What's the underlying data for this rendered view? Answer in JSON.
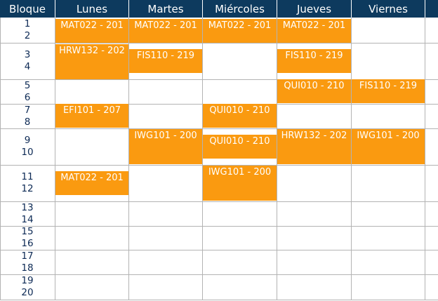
{
  "header": {
    "bloque_label": "Bloque",
    "days": [
      "Lunes",
      "Martes",
      "Miércoles",
      "Jueves",
      "Viernes"
    ]
  },
  "rows": [
    {
      "top": "1",
      "bottom": "2"
    },
    {
      "top": "3",
      "bottom": "4"
    },
    {
      "top": "5",
      "bottom": "6"
    },
    {
      "top": "7",
      "bottom": "8"
    },
    {
      "top": "9",
      "bottom": "10"
    },
    {
      "top": "11",
      "bottom": "12"
    },
    {
      "top": "13",
      "bottom": "14"
    },
    {
      "top": "15",
      "bottom": "16"
    },
    {
      "top": "17",
      "bottom": "18"
    },
    {
      "top": "19",
      "bottom": "20"
    }
  ],
  "courses": [
    {
      "day": 0,
      "row": 0,
      "label": "MAT022 - 201"
    },
    {
      "day": 1,
      "row": 0,
      "label": "MAT022 - 201"
    },
    {
      "day": 2,
      "row": 0,
      "label": "MAT022 - 201"
    },
    {
      "day": 3,
      "row": 0,
      "label": "MAT022 - 201"
    },
    {
      "day": 0,
      "row": 1,
      "label": "HRW132 - 202"
    },
    {
      "day": 1,
      "row": 1,
      "label": "FIS110 - 219"
    },
    {
      "day": 3,
      "row": 1,
      "label": "FIS110 - 219"
    },
    {
      "day": 3,
      "row": 2,
      "label": "QUI010 - 210"
    },
    {
      "day": 4,
      "row": 2,
      "label": "FIS110 - 219"
    },
    {
      "day": 0,
      "row": 3,
      "label": "EFI101 - 207"
    },
    {
      "day": 2,
      "row": 3,
      "label": "QUI010 - 210"
    },
    {
      "day": 1,
      "row": 4,
      "label": "IWG101 - 200"
    },
    {
      "day": 2,
      "row": 4,
      "label": "QUI010 - 210"
    },
    {
      "day": 3,
      "row": 4,
      "label": "HRW132 - 202"
    },
    {
      "day": 4,
      "row": 4,
      "label": "IWG101 - 200"
    },
    {
      "day": 0,
      "row": 5,
      "label": "MAT022 - 201"
    },
    {
      "day": 2,
      "row": 5,
      "label": "IWG101 - 200"
    }
  ],
  "colors": {
    "header_bg": "#0d3a5e",
    "course_block": "#fa9a10",
    "grid_line": "#b3b3b3",
    "row_label_text": "#0d2a55"
  }
}
